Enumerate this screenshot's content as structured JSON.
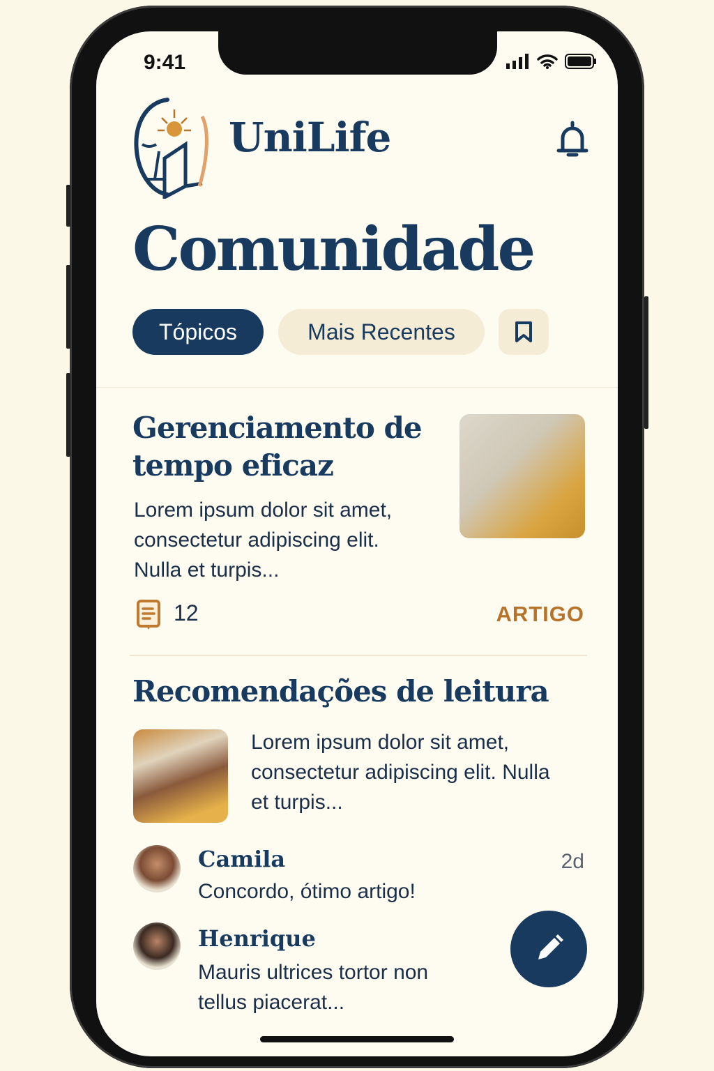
{
  "status_bar": {
    "time": "9:41"
  },
  "header": {
    "brand": "UniLife",
    "logo_icon": "face-book-sun-logo",
    "notification_icon": "bell-icon"
  },
  "page_title": "Comunidade",
  "tabs": [
    {
      "label": "Tópicos",
      "active": true
    },
    {
      "label": "Mais Recentes",
      "active": false
    }
  ],
  "bookmark_icon": "bookmark-icon",
  "posts": [
    {
      "title_line1": "Gerenciamento de",
      "title_line2": "tempo eficaz",
      "excerpt": [
        "Lorem ipsum dolor sit amet,",
        "consectetur adipiscing elit.",
        "Nulla et turpis..."
      ],
      "count": "12",
      "type": "ARTIGO"
    },
    {
      "title": "Recomendações de leitura",
      "excerpt": [
        "Lorem ipsum dolor sit amet,",
        "consectetur adipiscing elit. Nulla",
        "et turpis..."
      ]
    }
  ],
  "comments": [
    {
      "author": "Camila",
      "text": "Concordo, ótimo artigo!",
      "time": "2d"
    },
    {
      "author": "Henrique",
      "text": [
        "Mauris ultrices tortor non",
        "tellus piacerat..."
      ]
    }
  ],
  "colors": {
    "navy": "#173a5e",
    "accent": "#b8732a",
    "cream": "#fefcf1",
    "pill": "#f5ecd6"
  },
  "fab_icon": "pencil-icon"
}
